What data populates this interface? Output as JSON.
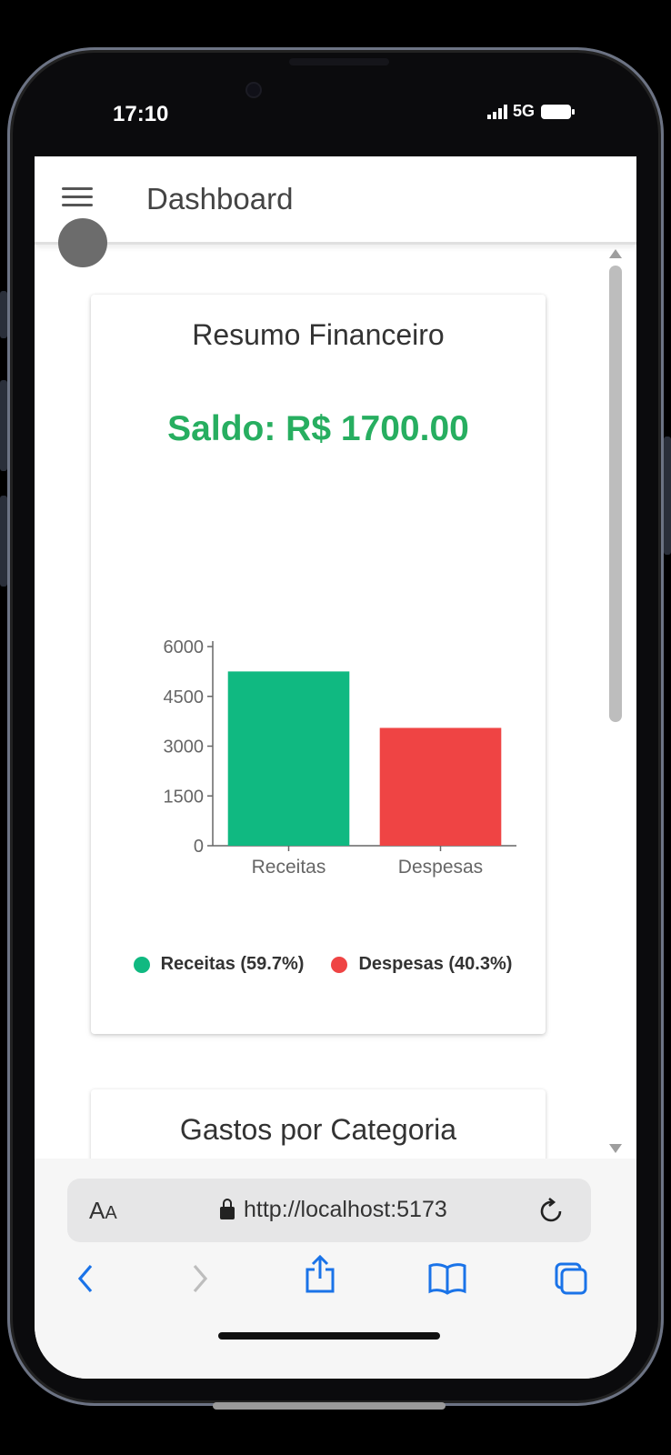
{
  "status_bar": {
    "time": "17:10",
    "network": "5G"
  },
  "app": {
    "title": "Dashboard"
  },
  "summary_card": {
    "title": "Resumo Financeiro",
    "saldo": "Saldo: R$ 1700.00",
    "legend": [
      {
        "label": "Receitas (59.7%)",
        "color": "#10b981"
      },
      {
        "label": "Despesas (40.3%)",
        "color": "#ef4444"
      }
    ]
  },
  "chart_data": {
    "type": "bar",
    "categories": [
      "Receitas",
      "Despesas"
    ],
    "values": [
      5250,
      3550
    ],
    "colors": [
      "#10b981",
      "#ef4444"
    ],
    "ylim": [
      0,
      6000
    ],
    "yticks": [
      "0",
      "1500",
      "3000",
      "4500",
      "6000"
    ],
    "grid": false
  },
  "category_card": {
    "title": "Gastos por Categoria"
  },
  "browser": {
    "aa_label": "AA",
    "url": "http://localhost:5173"
  },
  "icons": {
    "menu": "menu-icon",
    "reload": "reload-icon",
    "back": "chevron-left-icon",
    "forward": "chevron-right-icon",
    "share": "share-icon",
    "bookmarks": "book-icon",
    "tabs": "tabs-icon"
  }
}
